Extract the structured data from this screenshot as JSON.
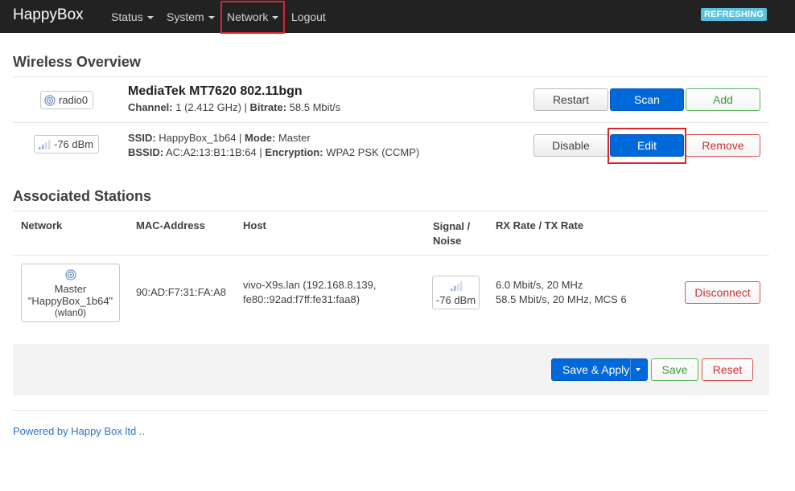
{
  "navbar": {
    "brand": "HappyBox",
    "items": [
      {
        "label": "Status"
      },
      {
        "label": "System"
      },
      {
        "label": "Network"
      },
      {
        "label": "Logout"
      }
    ],
    "badge": "REFRESHING"
  },
  "wireless": {
    "title": "Wireless Overview",
    "device": {
      "badge_label": "radio0",
      "name": "MediaTek MT7620 802.11bgn",
      "channel_label": "Channel:",
      "channel_value": "1 (2.412 GHz)",
      "bitrate_label": "Bitrate:",
      "bitrate_value": "58.5 Mbit/s",
      "buttons": {
        "restart": "Restart",
        "scan": "Scan",
        "add": "Add"
      }
    },
    "network": {
      "badge_label": "-76 dBm",
      "ssid_label": "SSID:",
      "ssid_value": "HappyBox_1b64",
      "mode_label": "Mode:",
      "mode_value": "Master",
      "bssid_label": "BSSID:",
      "bssid_value": "AC:A2:13:B1:1B:64",
      "encryption_label": "Encryption:",
      "encryption_value": "WPA2 PSK (CCMP)",
      "buttons": {
        "disable": "Disable",
        "edit": "Edit",
        "remove": "Remove"
      }
    }
  },
  "stations": {
    "title": "Associated Stations",
    "headers": {
      "network": "Network",
      "mac": "MAC-Address",
      "host": "Host",
      "signal_line1": "Signal /",
      "signal_line2": "Noise",
      "rate": "RX Rate / TX Rate"
    },
    "rows": [
      {
        "network_line1": "Master",
        "network_line2": "\"HappyBox_1b64\"",
        "network_line3": "(wlan0)",
        "mac": "90:AD:F7:31:FA:A8",
        "host_line1": "vivo-X9s.lan (192.168.8.139,",
        "host_line2": "fe80::92ad:f7ff:fe31:faa8)",
        "signal": "-76 dBm",
        "rate_line1": "6.0 Mbit/s, 20 MHz",
        "rate_line2": "58.5 Mbit/s, 20 MHz, MCS 6",
        "action": "Disconnect"
      }
    ]
  },
  "actions": {
    "save_apply": "Save & Apply",
    "save": "Save",
    "reset": "Reset"
  },
  "footer": {
    "powered": "Powered by Happy Box ltd .."
  },
  "colors": {
    "navbar": "#222222",
    "primary": "#0069d9",
    "highlight": "#d9262d",
    "badge": "#5bc0de"
  }
}
